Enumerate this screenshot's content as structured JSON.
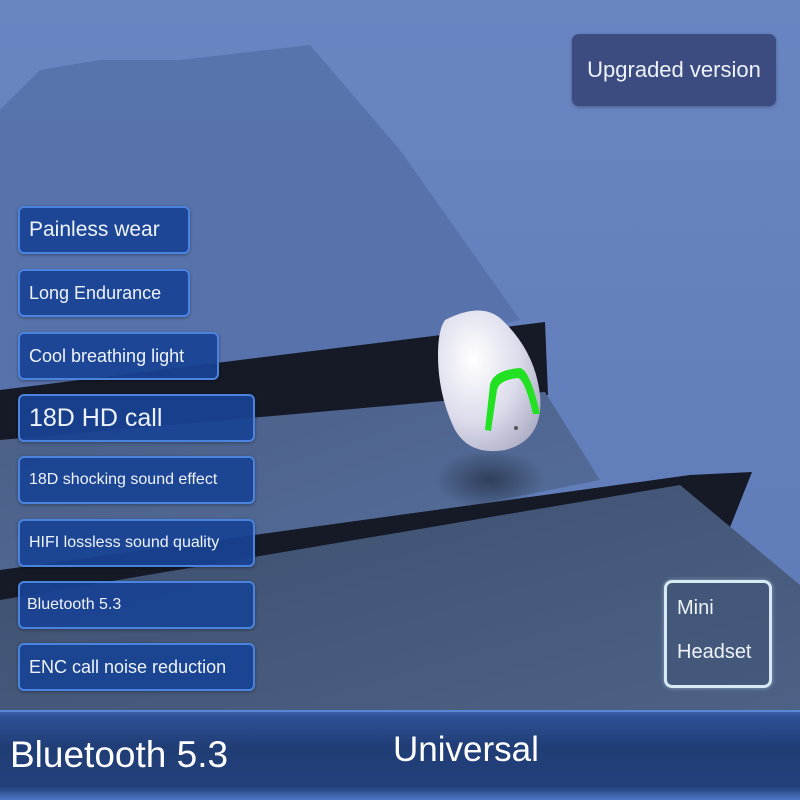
{
  "badge": {
    "label": "Upgraded version"
  },
  "features": [
    {
      "label": "Painless wear"
    },
    {
      "label": "Long Endurance"
    },
    {
      "label": "Cool breathing light"
    },
    {
      "label": "18D HD call"
    },
    {
      "label": "18D shocking sound effect"
    },
    {
      "label": "HIFI lossless sound quality"
    },
    {
      "label": "Bluetooth 5.3"
    },
    {
      "label": "ENC call noise reduction"
    }
  ],
  "product_tag": {
    "line1": "Mini",
    "line2": "Headset"
  },
  "bottom_bar": {
    "left_text": "Bluetooth 5.3",
    "right_text": "Universal"
  },
  "colors": {
    "chip_fill": "#184294",
    "chip_border": "#4a84df",
    "breathing_light": "#22e022"
  }
}
